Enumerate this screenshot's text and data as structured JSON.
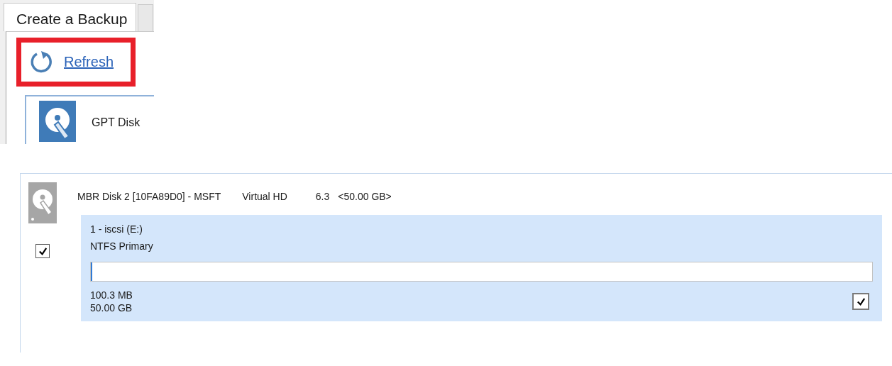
{
  "tabs": [
    {
      "label": "Create a Backup",
      "selected": true
    }
  ],
  "refresh_link": {
    "label": "Refresh",
    "highlighted": true
  },
  "top_disk": {
    "name": "GPT Disk"
  },
  "disk": {
    "name": "MBR Disk 2 [10FA89D0] - MSFT",
    "model": "Virtual HD",
    "version": "6.3",
    "size": "<50.00 GB>",
    "checked": true,
    "partitions": [
      {
        "label": "1 - iscsi (E:)",
        "type": "NTFS Primary",
        "level": 0.002,
        "used": "100.3 MB",
        "total": "50.00 GB",
        "checked": true
      }
    ]
  }
}
